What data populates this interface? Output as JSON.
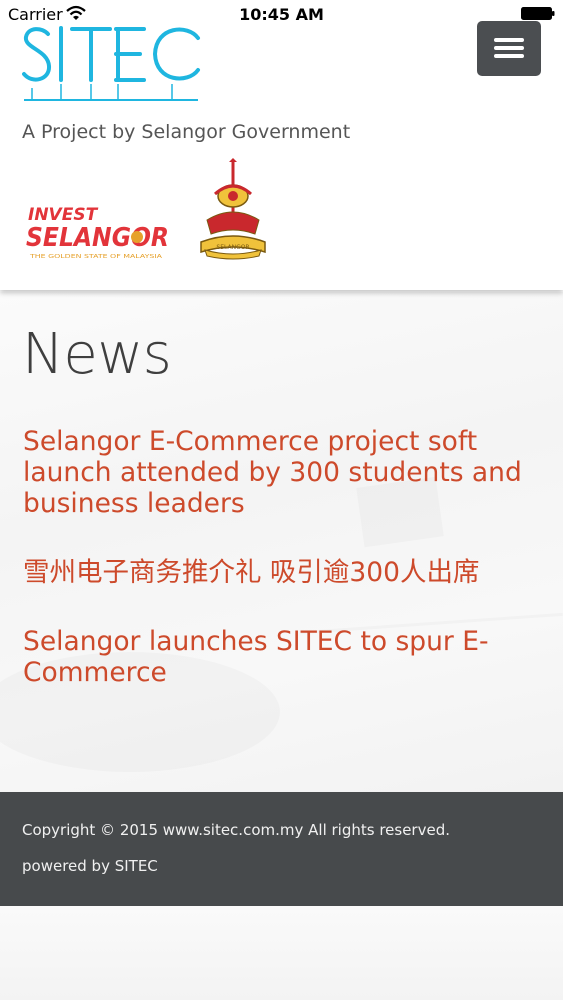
{
  "status_bar": {
    "carrier": "Carrier",
    "time": "10:45 AM"
  },
  "header": {
    "logo_text": "SITEC",
    "tagline": "A Project by Selangor Government",
    "invest_logo_line1": "INVEST",
    "invest_logo_line2": "SELANGOR",
    "invest_logo_subtitle": "THE GOLDEN STATE OF MALAYSIA",
    "crest_label": "SELANGOR",
    "menu_icon": "hamburger-icon"
  },
  "main": {
    "title": "News",
    "news_items": [
      {
        "title": "Selangor E-Commerce project soft launch attended by 300 students and business leaders"
      },
      {
        "title": "雪州电子商务推介礼 吸引逾300人出席"
      },
      {
        "title": "Selangor launches SITEC to spur E-Commerce"
      }
    ]
  },
  "footer": {
    "copyright": "Copyright © 2015 www.sitec.com.my All rights reserved.",
    "powered_by": "powered by SITEC"
  },
  "colors": {
    "link": "#cd4a2b",
    "logo_blue": "#1fb6e0",
    "footer_bg": "#474a4c",
    "menu_button": "#4b4e51"
  }
}
